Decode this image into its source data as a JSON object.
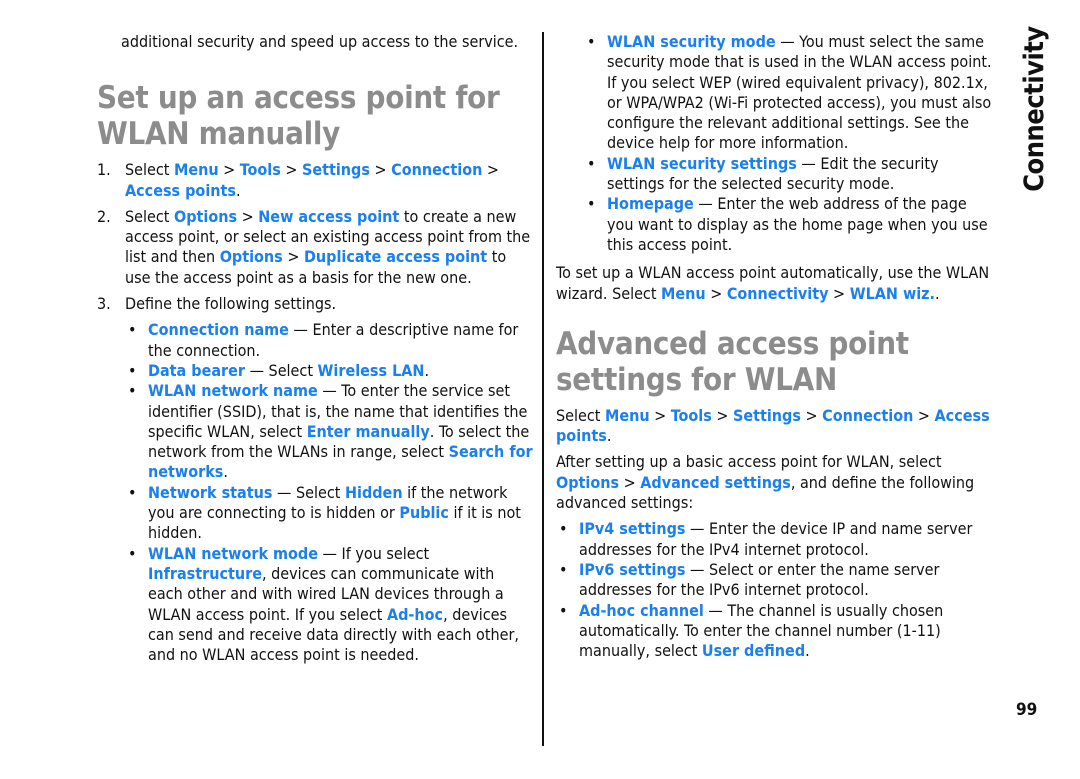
{
  "section_tab": "Connectivity",
  "page_number": "99",
  "colors": {
    "link": "#1a7fef",
    "heading": "#8c8c8c",
    "text": "#111111"
  },
  "left": {
    "intro": "additional security and speed up access to the service.",
    "heading": "Set up an access point for WLAN manually",
    "step1": {
      "num": "1.",
      "t1": "Select ",
      "l1": "Menu",
      "s1": " > ",
      "l2": "Tools",
      "s2": " > ",
      "l3": "Settings",
      "s3": " > ",
      "l4": "Connection",
      "s4": " > ",
      "l5": "Access points",
      "t2": "."
    },
    "step2": {
      "num": "2.",
      "t1": "Select ",
      "l1": "Options",
      "s1": " > ",
      "l2": "New access point",
      "t2": " to create a new access point, or select an existing access point from the list and then ",
      "l3": "Options",
      "s2": " > ",
      "l4": "Duplicate access point",
      "t3": " to use the access point as a basis for the new one."
    },
    "step3": {
      "num": "3.",
      "text": "Define the following settings."
    },
    "bullets": [
      {
        "l1": "Connection name",
        "t1": " — Enter a descriptive name for the connection."
      },
      {
        "l1": "Data bearer",
        "t1": " — Select ",
        "l2": "Wireless LAN",
        "t2": "."
      },
      {
        "l1": "WLAN network name",
        "t1": " — To enter the service set identifier (SSID), that is, the name that identifies the specific WLAN, select ",
        "l2": "Enter manually",
        "t2": ". To select the network from the WLANs in range, select ",
        "l3": "Search for networks",
        "t3": "."
      },
      {
        "l1": "Network status",
        "t1": " — Select ",
        "l2": "Hidden",
        "t2": " if the network you are connecting to is hidden or ",
        "l3": "Public",
        "t3": " if it is not hidden."
      },
      {
        "l1": "WLAN network mode",
        "t1": " — If you select ",
        "l2": "Infrastructure",
        "t2": ", devices can communicate with each other and with wired LAN devices through a WLAN access point. If you select ",
        "l3": "Ad-hoc",
        "t3": ", devices can send and receive data directly with each other, and no WLAN access point is needed."
      }
    ]
  },
  "right": {
    "bullets": [
      {
        "l1": "WLAN security mode",
        "t1": " — You must select the same security mode that is used in the WLAN access point. If you select WEP (wired equivalent privacy), 802.1x, or WPA/WPA2 (Wi-Fi protected access), you must also configure the relevant additional settings. See the device help for more information."
      },
      {
        "l1": "WLAN security settings",
        "t1": " — Edit the security settings for the selected security mode."
      },
      {
        "l1": "Homepage",
        "t1": " — Enter the web address of the page you want to display as the home page when you use this access point."
      }
    ],
    "auto_para": {
      "t1": "To set up a WLAN access point automatically, use the WLAN wizard. Select ",
      "l1": "Menu",
      "s1": " > ",
      "l2": "Connectivity",
      "s2": " > ",
      "l3": "WLAN wiz.",
      "t2": "."
    },
    "heading": "Advanced access point settings for WLAN",
    "path": {
      "t1": "Select ",
      "l1": "Menu",
      "s1": " > ",
      "l2": "Tools",
      "s2": " > ",
      "l3": "Settings",
      "s3": " > ",
      "l4": "Connection",
      "s4": " > ",
      "l5": "Access points",
      "t2": "."
    },
    "after_para": {
      "t1": "After setting up a basic access point for WLAN, select ",
      "l1": "Options",
      "s1": " > ",
      "l2": "Advanced settings",
      "t2": ", and define the following advanced settings:"
    },
    "adv_bullets": [
      {
        "l1": "IPv4 settings",
        "t1": " — Enter the device IP and name server addresses for the IPv4 internet protocol."
      },
      {
        "l1": "IPv6 settings",
        "t1": " — Select or enter the name server addresses for the IPv6 internet protocol."
      },
      {
        "l1": "Ad-hoc channel",
        "t1": " — The channel is usually chosen automatically. To enter the channel number (1-11) manually, select ",
        "l2": "User defined",
        "t2": "."
      }
    ]
  }
}
